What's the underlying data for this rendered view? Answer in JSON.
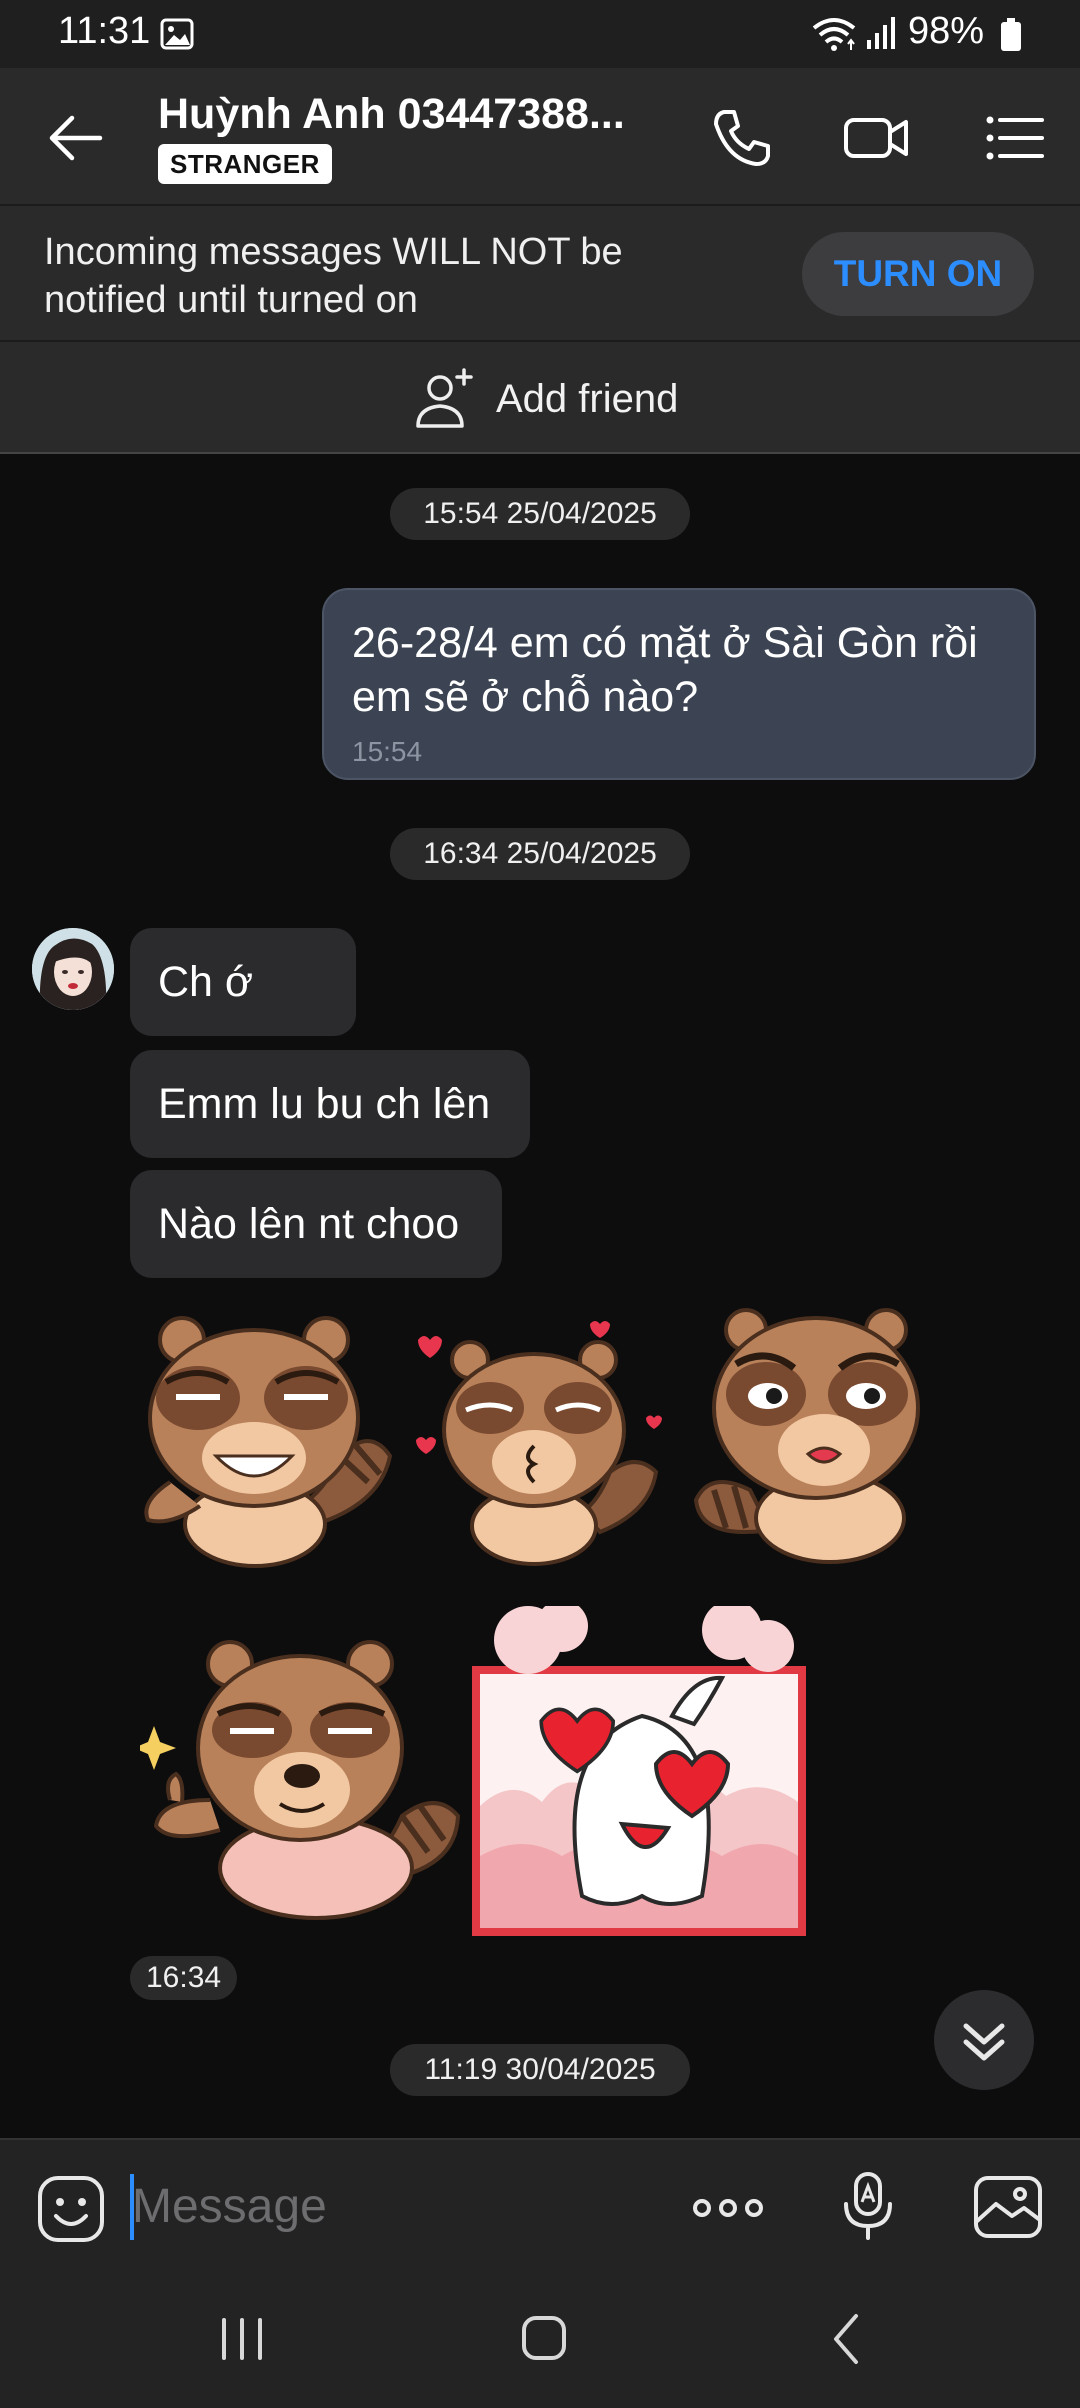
{
  "status_bar": {
    "time": "11:31",
    "battery": "98%"
  },
  "header": {
    "contact_name": "Huỳnh Anh 03447388...",
    "badge": "STRANGER"
  },
  "notify_banner": {
    "text": "Incoming messages WILL NOT be notified until turned on",
    "button_label": "TURN ON"
  },
  "add_friend": {
    "label": "Add friend"
  },
  "messages": {
    "date1": "15:54 25/04/2025",
    "outgoing": {
      "text": "26-28/4 em có mặt ở Sài Gòn rồi em sẽ ở chỗ nào?",
      "time": "15:54"
    },
    "date2": "16:34 25/04/2025",
    "incoming": [
      "Ch ớ",
      "Emm lu bu ch lên",
      "Nào lên nt choo"
    ],
    "incoming_time": "16:34",
    "date3": "11:19 30/04/2025"
  },
  "composer": {
    "placeholder": "Message"
  },
  "colors": {
    "accent": "#2c8dff",
    "outgoing_bubble": "#3c4453",
    "incoming_bubble": "#2b2b2d",
    "background": "#0d0d0e"
  }
}
